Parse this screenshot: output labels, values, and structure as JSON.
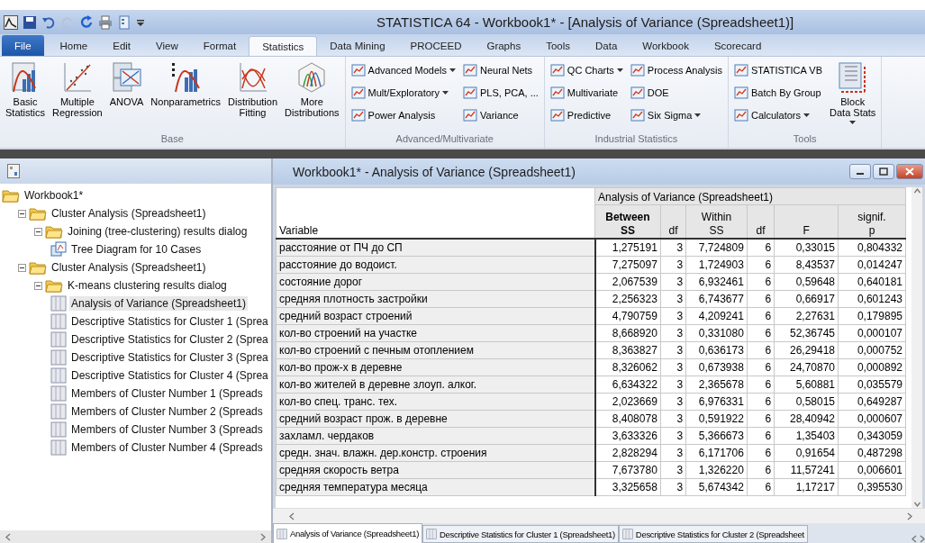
{
  "title_bar": {
    "title": "STATISTICA 64 - Workbook1* - [Analysis of Variance (Spreadsheet1)]"
  },
  "ribbon_tabs": [
    {
      "label": "File",
      "kind": "file",
      "selected": false
    },
    {
      "label": "Home",
      "kind": "tab",
      "selected": false
    },
    {
      "label": "Edit",
      "kind": "tab",
      "selected": false
    },
    {
      "label": "View",
      "kind": "tab",
      "selected": false
    },
    {
      "label": "Format",
      "kind": "tab",
      "selected": false
    },
    {
      "label": "Statistics",
      "kind": "tab",
      "selected": true
    },
    {
      "label": "Data Mining",
      "kind": "tab",
      "selected": false
    },
    {
      "label": "PROCEED",
      "kind": "tab",
      "selected": false
    },
    {
      "label": "Graphs",
      "kind": "tab",
      "selected": false
    },
    {
      "label": "Tools",
      "kind": "tab",
      "selected": false
    },
    {
      "label": "Data",
      "kind": "tab",
      "selected": false
    },
    {
      "label": "Workbook",
      "kind": "tab",
      "selected": false
    },
    {
      "label": "Scorecard",
      "kind": "tab",
      "selected": false
    }
  ],
  "ribbon_groups": [
    {
      "name": "Base",
      "columns": [
        [
          {
            "kind": "large",
            "label": "Basic Statistics",
            "dropdown": false
          }
        ],
        [
          {
            "kind": "large",
            "label": "Multiple Regression",
            "dropdown": false
          }
        ],
        [
          {
            "kind": "large",
            "label": "ANOVA",
            "dropdown": false
          }
        ],
        [
          {
            "kind": "large",
            "label": "Nonparametrics",
            "dropdown": false
          }
        ],
        [
          {
            "kind": "large",
            "label": "Distribution Fitting",
            "dropdown": false
          }
        ],
        [
          {
            "kind": "large",
            "label": "More Distributions",
            "dropdown": false
          }
        ]
      ]
    },
    {
      "name": "Advanced/Multivariate",
      "columns": [
        [
          {
            "kind": "small",
            "label": "Advanced Models",
            "dropdown": true
          },
          {
            "kind": "small",
            "label": "Mult/Exploratory",
            "dropdown": true
          },
          {
            "kind": "small",
            "label": "Power Analysis",
            "dropdown": false
          }
        ],
        [
          {
            "kind": "small",
            "label": "Neural Nets",
            "dropdown": false
          },
          {
            "kind": "small",
            "label": "PLS, PCA, ...",
            "dropdown": false
          },
          {
            "kind": "small",
            "label": "Variance",
            "dropdown": false
          }
        ]
      ]
    },
    {
      "name": "Industrial Statistics",
      "columns": [
        [
          {
            "kind": "small",
            "label": "QC Charts",
            "dropdown": true
          },
          {
            "kind": "small",
            "label": "Multivariate",
            "dropdown": false
          },
          {
            "kind": "small",
            "label": "Predictive",
            "dropdown": false
          }
        ],
        [
          {
            "kind": "small",
            "label": "Process Analysis",
            "dropdown": false
          },
          {
            "kind": "small",
            "label": "DOE",
            "dropdown": false
          },
          {
            "kind": "small",
            "label": "Six Sigma",
            "dropdown": true
          }
        ]
      ]
    },
    {
      "name": "Tools",
      "columns": [
        [
          {
            "kind": "small",
            "label": "STATISTICA VB",
            "dropdown": false
          },
          {
            "kind": "small",
            "label": "Batch By Group",
            "dropdown": false
          },
          {
            "kind": "small",
            "label": "Calculators",
            "dropdown": true
          }
        ],
        [
          {
            "kind": "large",
            "label": "Block Data Stats",
            "dropdown": true
          }
        ]
      ]
    }
  ],
  "workbook_tree": [
    {
      "label": "Workbook1*",
      "kind": "folder",
      "selected": false,
      "children": [
        {
          "label": "Cluster Analysis (Spreadsheet1)",
          "kind": "folder",
          "selected": false,
          "expanded": true,
          "children": [
            {
              "label": "Joining (tree-clustering) results dialog",
              "kind": "folder",
              "selected": false,
              "expanded": true,
              "children": [
                {
                  "label": "Tree Diagram for 10 Cases",
                  "kind": "graph",
                  "selected": false
                }
              ]
            }
          ]
        },
        {
          "label": "Cluster Analysis (Spreadsheet1)",
          "kind": "folder",
          "selected": false,
          "expanded": true,
          "children": [
            {
              "label": "K-means clustering results dialog",
              "kind": "folder",
              "selected": false,
              "expanded": true,
              "children": [
                {
                  "label": "Analysis of Variance (Spreadsheet1)",
                  "kind": "sheet",
                  "selected": true
                },
                {
                  "label": "Descriptive Statistics for Cluster 1 (Sprea",
                  "kind": "sheet",
                  "selected": false
                },
                {
                  "label": "Descriptive Statistics for Cluster 2 (Sprea",
                  "kind": "sheet",
                  "selected": false
                },
                {
                  "label": "Descriptive Statistics for Cluster 3 (Sprea",
                  "kind": "sheet",
                  "selected": false
                },
                {
                  "label": "Descriptive Statistics for Cluster 4 (Sprea",
                  "kind": "sheet",
                  "selected": false
                },
                {
                  "label": "Members of Cluster Number 1 (Spreads",
                  "kind": "sheet",
                  "selected": false
                },
                {
                  "label": "Members of Cluster Number 2 (Spreads",
                  "kind": "sheet",
                  "selected": false
                },
                {
                  "label": "Members of Cluster Number 3 (Spreads",
                  "kind": "sheet",
                  "selected": false
                },
                {
                  "label": "Members of Cluster Number 4 (Spreads",
                  "kind": "sheet",
                  "selected": false
                }
              ]
            }
          ]
        }
      ]
    }
  ],
  "spreadsheet_window": {
    "title": "Workbook1* - Analysis of Variance (Spreadsheet1)",
    "table": {
      "group_header": "Analysis of Variance (Spreadsheet1)",
      "columns": [
        {
          "label": "Variable",
          "bold": false
        },
        {
          "label": "Between\nSS",
          "bold": true
        },
        {
          "label": "df",
          "bold": false
        },
        {
          "label": "Within\nSS",
          "bold": false
        },
        {
          "label": "df",
          "bold": false
        },
        {
          "label": "F",
          "bold": false
        },
        {
          "label": "signif.\np",
          "bold": false
        }
      ],
      "rows": [
        [
          "расстояние от ПЧ до СП",
          "1,275191",
          "3",
          "7,724809",
          "6",
          "0,33015",
          "0,804332"
        ],
        [
          "расстояние до водоист.",
          "7,275097",
          "3",
          "1,724903",
          "6",
          "8,43537",
          "0,014247"
        ],
        [
          "состояние дорог",
          "2,067539",
          "3",
          "6,932461",
          "6",
          "0,59648",
          "0,640181"
        ],
        [
          "средняя плотность застройки",
          "2,256323",
          "3",
          "6,743677",
          "6",
          "0,66917",
          "0,601243"
        ],
        [
          "средний возраст строений",
          "4,790759",
          "3",
          "4,209241",
          "6",
          "2,27631",
          "0,179895"
        ],
        [
          "кол-во строений на участке",
          "8,668920",
          "3",
          "0,331080",
          "6",
          "52,36745",
          "0,000107"
        ],
        [
          "кол-во строений с печным отоплением",
          "8,363827",
          "3",
          "0,636173",
          "6",
          "26,29418",
          "0,000752"
        ],
        [
          "кол-во прож-х в деревне",
          "8,326062",
          "3",
          "0,673938",
          "6",
          "24,70870",
          "0,000892"
        ],
        [
          "кол-во жителей в деревне злоуп. алког.",
          "6,634322",
          "3",
          "2,365678",
          "6",
          "5,60881",
          "0,035579"
        ],
        [
          "кол-во спец. транс. тех.",
          "2,023669",
          "3",
          "6,976331",
          "6",
          "0,58015",
          "0,649287"
        ],
        [
          "средний возраст прож. в деревне",
          "8,408078",
          "3",
          "0,591922",
          "6",
          "28,40942",
          "0,000607"
        ],
        [
          "захламл. чердаков",
          "3,633326",
          "3",
          "5,366673",
          "6",
          "1,35403",
          "0,343059"
        ],
        [
          "средн. знач. влажн. дер.констр. строения",
          "2,828294",
          "3",
          "6,171706",
          "6",
          "0,91654",
          "0,487298"
        ],
        [
          "средняя скорость ветра",
          "7,673780",
          "3",
          "1,326220",
          "6",
          "11,57241",
          "0,006601"
        ],
        [
          "средняя температура месяца",
          "3,325658",
          "3",
          "5,674342",
          "6",
          "1,17217",
          "0,395530"
        ]
      ]
    },
    "sheet_tabs": [
      {
        "label": "Analysis of Variance (Spreadsheet1)",
        "selected": true
      },
      {
        "label": "Descriptive Statistics for Cluster 1 (Spreadsheet1)",
        "selected": false
      },
      {
        "label": "Descriptive Statistics for Cluster 2 (Spreadsheet",
        "selected": false
      }
    ]
  }
}
